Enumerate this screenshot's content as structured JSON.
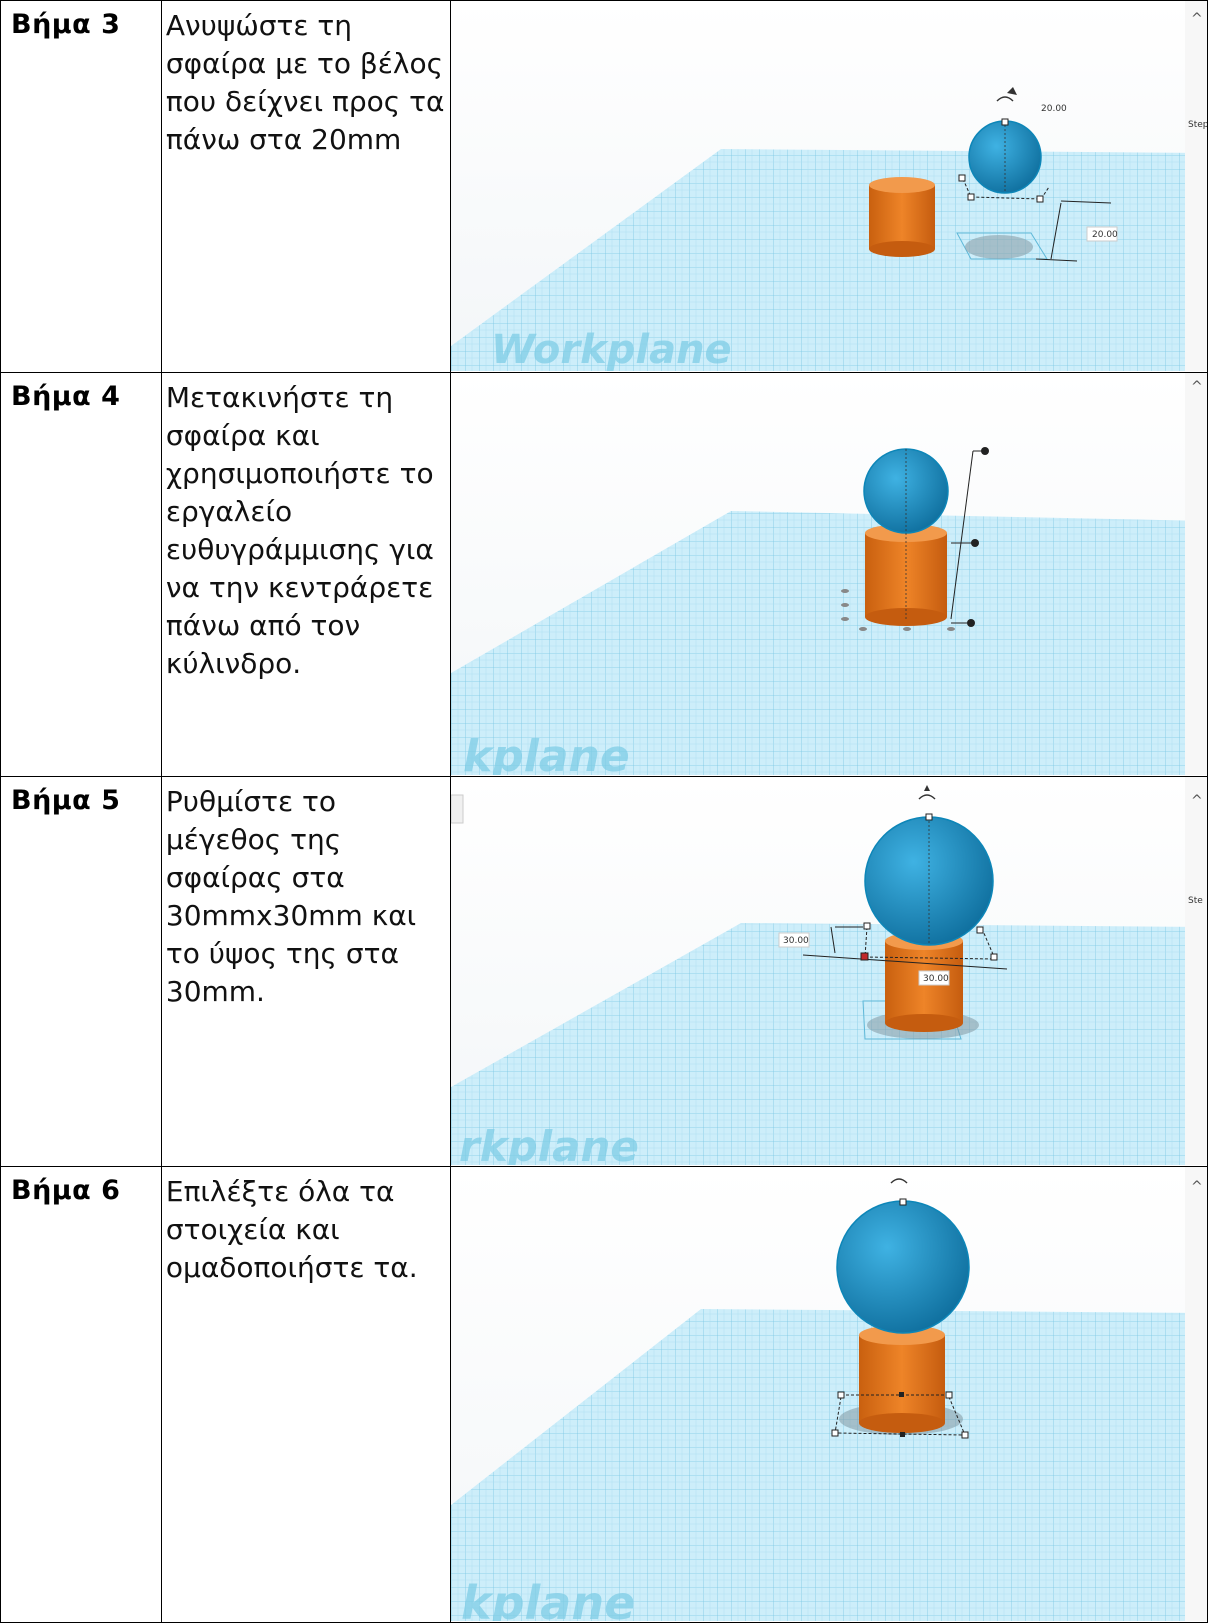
{
  "steps": [
    {
      "label": "Βήμα 3",
      "text": "Ανυψώστε τη σφαίρα με το βέλος που δείχνει προς τα πάνω στα 20mm",
      "screenshot": {
        "watermark": "Workplane",
        "dims": [
          "20.00",
          "20.00"
        ],
        "side_label": "Step"
      }
    },
    {
      "label": "Βήμα 4",
      "text": "Μετακινήστε τη σφαίρα και χρησιμοποιήστε το εργαλείο ευθυγράμμισης για να την κεντράρετε πάνω από τον κύλινδρο.",
      "screenshot": {
        "watermark": "kplane"
      }
    },
    {
      "label": "Βήμα 5",
      "text": "Ρυθμίστε το μέγεθος της σφαίρας στα 30mmx30mm και το ύψος της στα 30mm.",
      "screenshot": {
        "watermark": "rkplane",
        "dims": [
          "30.00",
          "30.00"
        ],
        "side_label": "Ste"
      }
    },
    {
      "label": "Βήμα 6",
      "text": "Επιλέξτε όλα τα στοιχεία και ομαδοποιήστε τα.",
      "screenshot": {
        "watermark": "kplane"
      }
    }
  ],
  "colors": {
    "grid": "#8fd3ea",
    "sphere": "#1b8fc2",
    "cylinder": "#e87a22",
    "border": "#000000"
  },
  "icons": [
    "chevron-up-icon",
    "rotate-arrow-icon"
  ]
}
